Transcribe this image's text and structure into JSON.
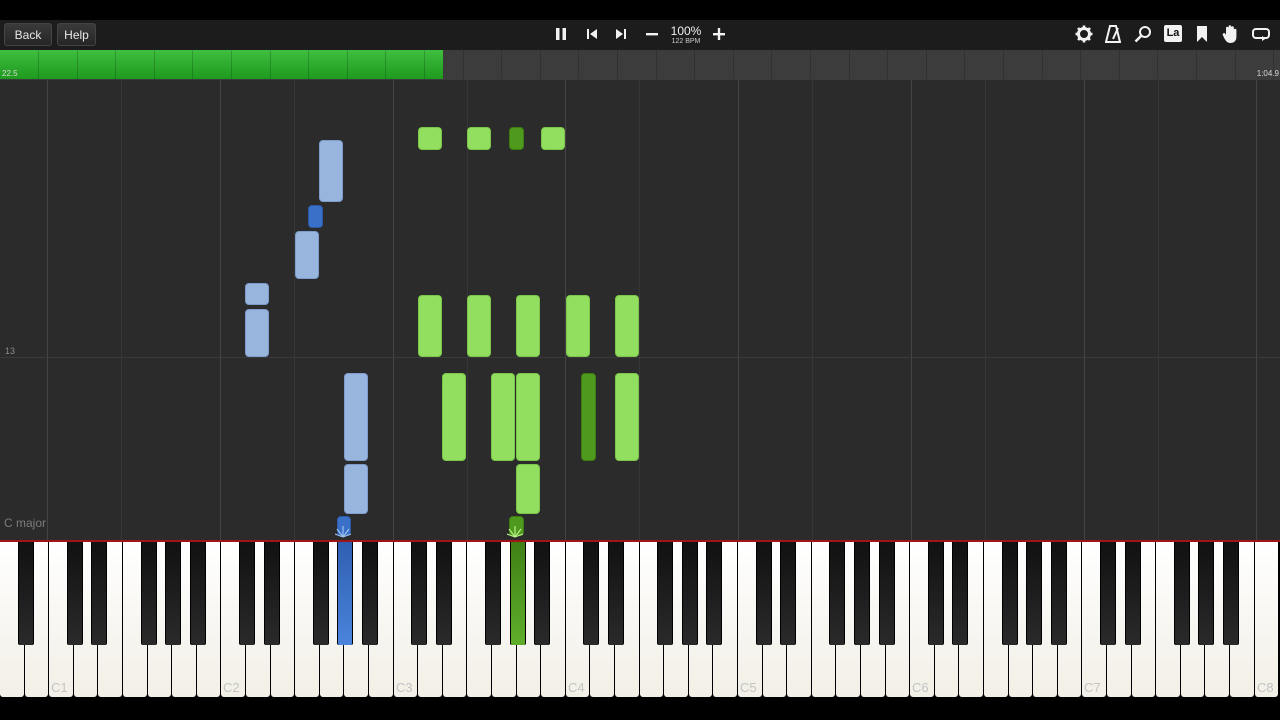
{
  "toolbar": {
    "back_label": "Back",
    "help_label": "Help",
    "zoom_percent": "100%",
    "tempo": "122 BPM",
    "icons": [
      "pause-icon",
      "previous-icon",
      "next-icon",
      "minus-icon",
      "plus-icon",
      "gear-icon",
      "metronome-icon",
      "search-icon",
      "label-icon",
      "bookmark-icon",
      "hand-icon",
      "loop-icon"
    ],
    "label_icon_text": "La"
  },
  "progress": {
    "start_time": "22.5",
    "end_time": "1:04.9",
    "fraction": 0.346,
    "color": "#22a822"
  },
  "roll": {
    "measure_number": "13",
    "key_signature": "C major",
    "colors": {
      "left_hand_light": "#98b5de",
      "left_hand_active": "#3b70c8",
      "right_hand_light": "#92de5e",
      "right_hand_active": "#4f9a1c"
    }
  },
  "keyboard": {
    "octave_labels": [
      "C1",
      "C2",
      "C3",
      "C4",
      "C5",
      "C6",
      "C7",
      "C8"
    ],
    "active_keys": [
      {
        "hand": "left",
        "color": "#3b70c8"
      },
      {
        "hand": "right",
        "color": "#5aa224"
      }
    ]
  }
}
